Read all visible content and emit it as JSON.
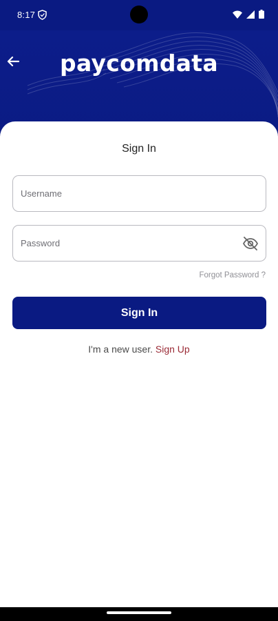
{
  "status_bar": {
    "time": "8:17",
    "icons": [
      "shield-icon",
      "wifi-icon",
      "signal-icon",
      "battery-icon"
    ]
  },
  "header": {
    "logo_text": "paycomdata",
    "back_icon": "arrow-left-icon",
    "background_color": "#0a1a82"
  },
  "form": {
    "title": "Sign In",
    "username_placeholder": "Username",
    "password_placeholder": "Password",
    "password_toggle_icon": "eye-off-icon",
    "forgot_password": "Forgot Password ?",
    "signin_button": "Sign In",
    "new_user_text": "I'm a new user.",
    "signup_link": "Sign Up"
  },
  "colors": {
    "primary": "#0a1a82",
    "link": "#9a2a35",
    "border": "#b9b9bf"
  }
}
